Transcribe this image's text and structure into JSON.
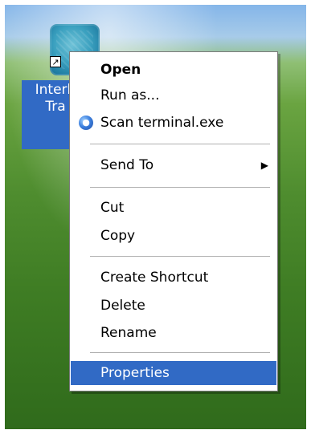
{
  "desktop_icon": {
    "label_line1": "Interb",
    "label_line2": "Tra"
  },
  "context_menu": {
    "items": [
      {
        "label": "Open"
      },
      {
        "label": "Run as..."
      },
      {
        "label": "Scan terminal.exe"
      },
      {
        "label": "Send To"
      },
      {
        "label": "Cut"
      },
      {
        "label": "Copy"
      },
      {
        "label": "Create Shortcut"
      },
      {
        "label": "Delete"
      },
      {
        "label": "Rename"
      },
      {
        "label": "Properties"
      }
    ],
    "selected_item": "Properties"
  },
  "colors": {
    "selection": "#316ac5",
    "menu_background": "#ffffff"
  },
  "icons": {
    "shortcut_overlay": "shortcut-arrow-icon",
    "scan": "antivirus-scan-icon",
    "submenu": "submenu-arrow-icon"
  }
}
